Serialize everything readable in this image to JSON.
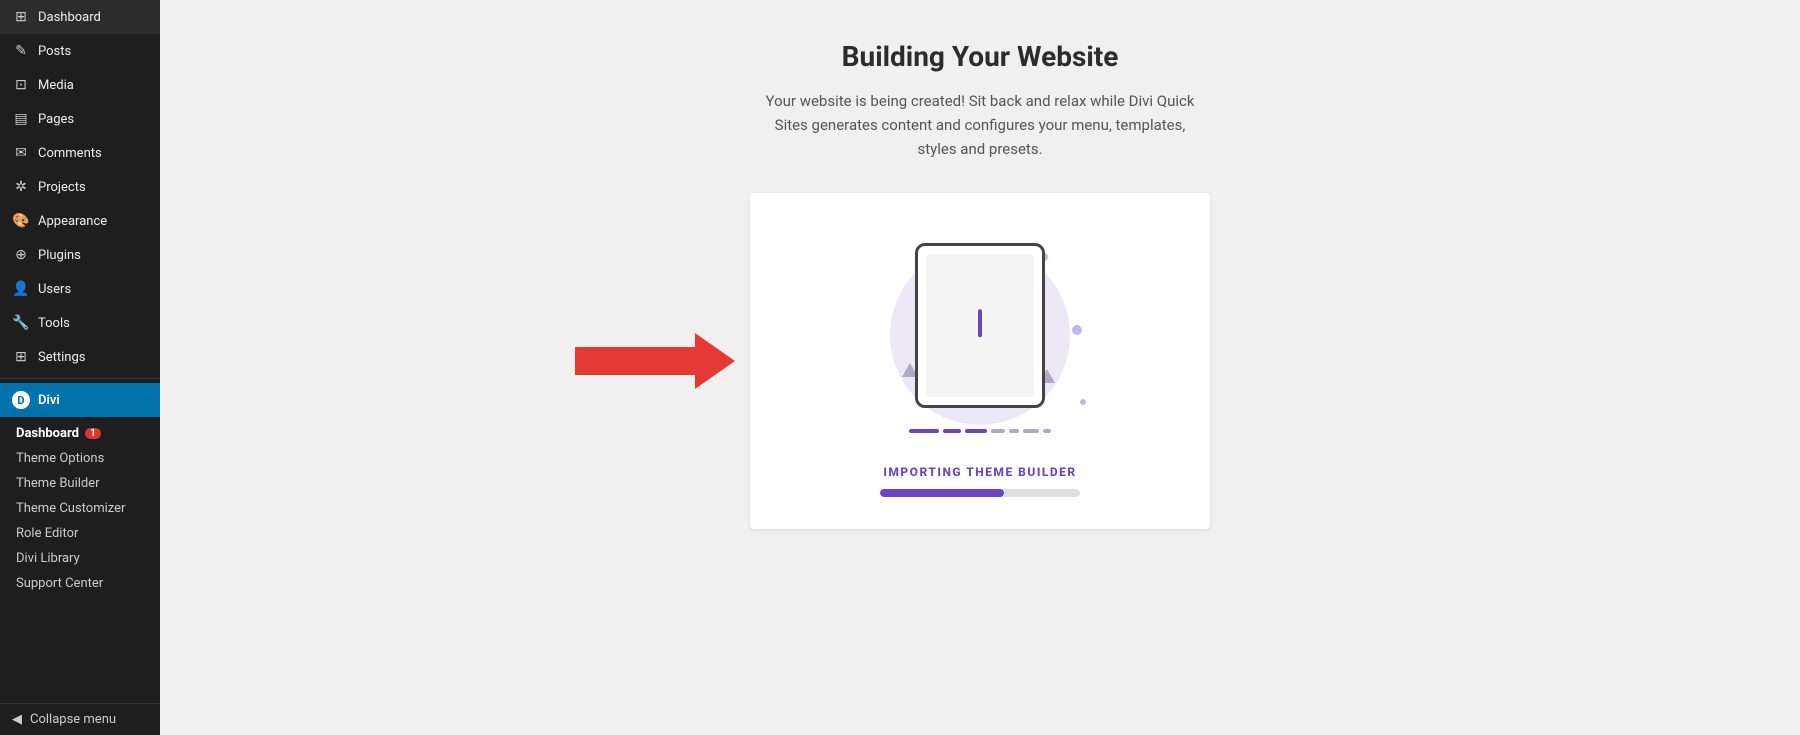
{
  "sidebar": {
    "items": [
      {
        "id": "dashboard",
        "label": "Dashboard",
        "icon": "⊞"
      },
      {
        "id": "posts",
        "label": "Posts",
        "icon": "✎"
      },
      {
        "id": "media",
        "label": "Media",
        "icon": "⊡"
      },
      {
        "id": "pages",
        "label": "Pages",
        "icon": "▤"
      },
      {
        "id": "comments",
        "label": "Comments",
        "icon": "✉"
      },
      {
        "id": "projects",
        "label": "Projects",
        "icon": "✲"
      },
      {
        "id": "appearance",
        "label": "Appearance",
        "icon": "🎨"
      },
      {
        "id": "plugins",
        "label": "Plugins",
        "icon": "⊕"
      },
      {
        "id": "users",
        "label": "Users",
        "icon": "👤"
      },
      {
        "id": "tools",
        "label": "Tools",
        "icon": "🔧"
      },
      {
        "id": "settings",
        "label": "Settings",
        "icon": "⊞"
      }
    ],
    "divi_item": {
      "label": "Divi",
      "icon": "D"
    },
    "divi_sub_items": [
      {
        "id": "divi-dashboard",
        "label": "Dashboard",
        "badge": "1"
      },
      {
        "id": "theme-options",
        "label": "Theme Options"
      },
      {
        "id": "theme-builder",
        "label": "Theme Builder"
      },
      {
        "id": "theme-customizer",
        "label": "Theme Customizer"
      },
      {
        "id": "role-editor",
        "label": "Role Editor"
      },
      {
        "id": "divi-library",
        "label": "Divi Library"
      },
      {
        "id": "support-center",
        "label": "Support Center"
      }
    ],
    "collapse_label": "Collapse menu"
  },
  "main": {
    "title": "Building Your Website",
    "subtitle": "Your website is being created! Sit back and relax while Divi Quick Sites generates content and configures your menu, templates, styles and presets.",
    "card": {
      "progress_label": "IMPORTING THEME BUILDER",
      "progress_percent": 62
    }
  }
}
